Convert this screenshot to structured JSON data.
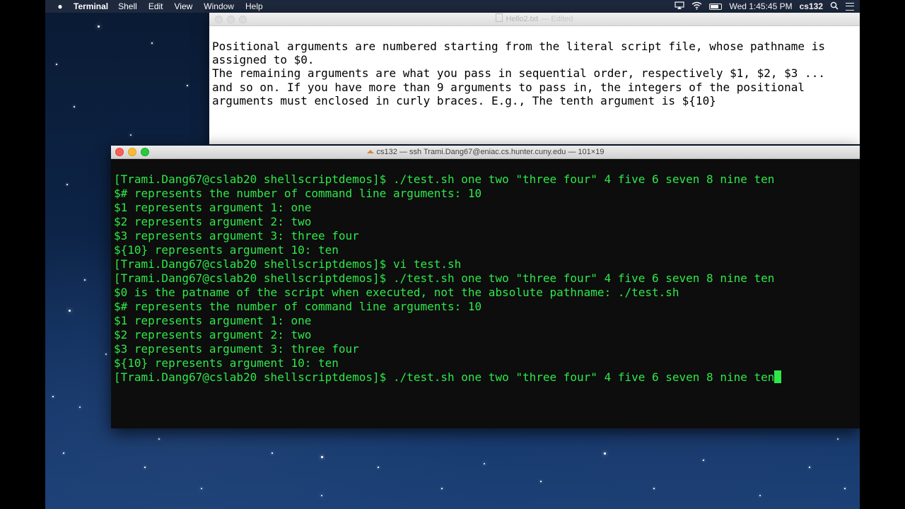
{
  "menubar": {
    "app_name": "Terminal",
    "menus": [
      "Shell",
      "Edit",
      "View",
      "Window",
      "Help"
    ],
    "clock": "Wed 1:45:45 PM",
    "user": "cs132"
  },
  "textedit": {
    "title": "Hello2.txt",
    "status": "— Edited",
    "lines": [
      "Positional arguments are numbered starting from the literal script file, whose pathname is",
      "assigned to $0.",
      "The remaining arguments are what you pass in sequential order, respectively $1, $2, $3 ...",
      "and so on. If you have more than 9 arguments to pass in, the integers of the positional",
      "arguments must enclosed in curly braces. E.g., The tenth argument is ${10}"
    ]
  },
  "terminal": {
    "title": "cs132 — ssh Trami.Dang67@eniac.cs.hunter.cuny.edu — 101×19",
    "lines": [
      {
        "bracket": "[",
        "text": "[Trami.Dang67@cslab20 shellscriptdemos]$ ./test.sh one two \"three four\" 4 five 6 seven 8 nine ten",
        "end": "]"
      },
      {
        "bracket": "[",
        "text": "$# represents the number of command line arguments: 10",
        "end": "]"
      },
      {
        "bracket": "",
        "text": "$1 represents argument 1: one",
        "end": ""
      },
      {
        "bracket": "",
        "text": "$2 represents argument 2: two",
        "end": ""
      },
      {
        "bracket": "",
        "text": "$3 represents argument 3: three four",
        "end": ""
      },
      {
        "bracket": "",
        "text": "${10} represents argument 10: ten",
        "end": ""
      },
      {
        "bracket": "[",
        "text": "[Trami.Dang67@cslab20 shellscriptdemos]$ vi test.sh",
        "end": "]"
      },
      {
        "bracket": "[",
        "text": "[Trami.Dang67@cslab20 shellscriptdemos]$ ./test.sh one two \"three four\" 4 five 6 seven 8 nine ten",
        "end": "]"
      },
      {
        "bracket": "",
        "text": "$0 is the patname of the script when executed, not the absolute pathname: ./test.sh",
        "end": ""
      },
      {
        "bracket": "",
        "text": "$# represents the number of command line arguments: 10",
        "end": ""
      },
      {
        "bracket": "",
        "text": "$1 represents argument 1: one",
        "end": ""
      },
      {
        "bracket": "",
        "text": "$2 represents argument 2: two",
        "end": ""
      },
      {
        "bracket": "",
        "text": "$3 represents argument 3: three four",
        "end": ""
      },
      {
        "bracket": "",
        "text": "${10} represents argument 10: ten",
        "end": ""
      },
      {
        "bracket": "",
        "text": "[Trami.Dang67@cslab20 shellscriptdemos]$ ./test.sh one two \"three four\" 4 five 6 seven 8 nine ten",
        "end": "",
        "cursor": true
      }
    ]
  },
  "colors": {
    "terminal_text": "#2ee84a",
    "terminal_bg": "#0d0d0d"
  }
}
